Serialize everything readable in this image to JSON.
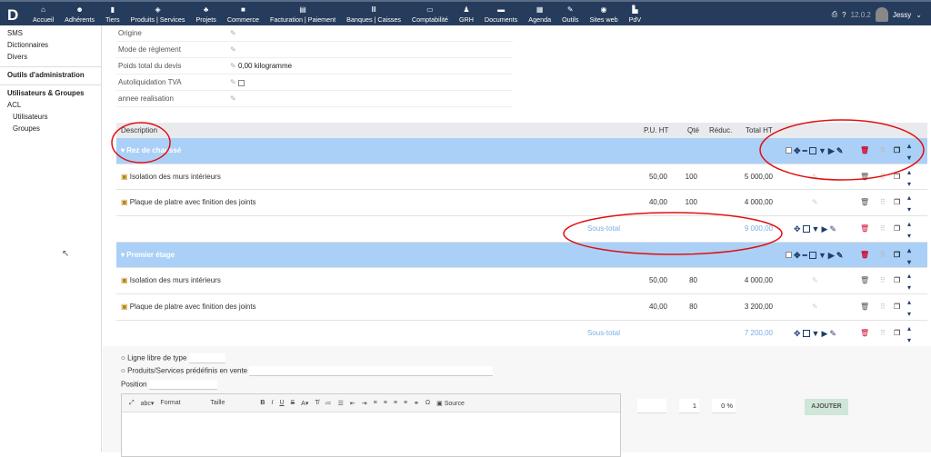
{
  "nav": {
    "logo": "D",
    "items": [
      {
        "icon": "home-icon",
        "glyph": "⌂",
        "label": "Accueil"
      },
      {
        "icon": "users-icon",
        "glyph": "☻",
        "label": "Adhérents"
      },
      {
        "icon": "building-icon",
        "glyph": "▮",
        "label": "Tiers"
      },
      {
        "icon": "cube-icon",
        "glyph": "◈",
        "label": "Produits | Services"
      },
      {
        "icon": "sitemap-icon",
        "glyph": "♣",
        "label": "Projets"
      },
      {
        "icon": "suitcase-icon",
        "glyph": "■",
        "label": "Commerce"
      },
      {
        "icon": "bills-icon",
        "glyph": "▤",
        "label": "Facturation | Paiement"
      },
      {
        "icon": "bank-icon",
        "glyph": "Ⅲ",
        "label": "Banques | Caisses"
      },
      {
        "icon": "calculator-icon",
        "glyph": "▭",
        "label": "Comptabilité"
      },
      {
        "icon": "user-tie-icon",
        "glyph": "♟",
        "label": "GRH"
      },
      {
        "icon": "folder-icon",
        "glyph": "▬",
        "label": "Documents"
      },
      {
        "icon": "calendar-icon",
        "glyph": "▦",
        "label": "Agenda"
      },
      {
        "icon": "wrench-icon",
        "glyph": "✎",
        "label": "Outils"
      },
      {
        "icon": "globe-icon",
        "glyph": "◉",
        "label": "Sites web"
      },
      {
        "icon": "cash-register-icon",
        "glyph": "▙",
        "label": "PdV"
      }
    ],
    "version": "12.0.2",
    "user": "Jessy"
  },
  "sidebar": {
    "items": [
      "SMS",
      "Dictionnaires",
      "Divers"
    ],
    "admin_tools": "Outils d'administration",
    "users_groups": "Utilisateurs & Groupes",
    "acl": "ACL",
    "users": "Utilisateurs",
    "groups": "Groupes"
  },
  "fields": [
    {
      "label": "Origine",
      "value": ""
    },
    {
      "label": "Mode de règlement",
      "value": ""
    },
    {
      "label": "Poids total du devis",
      "value": "0,00 kilogramme"
    },
    {
      "label": "Autoliquidation TVA",
      "value": ""
    },
    {
      "label": "annee realisation",
      "value": ""
    }
  ],
  "table": {
    "headers": {
      "desc": "Description",
      "pu": "P.U. HT",
      "qty": "Qté",
      "disc": "Réduc.",
      "total": "Total HT"
    },
    "groups": [
      {
        "title": "Rez de chaussé",
        "lines": [
          {
            "desc": "Isolation des murs intérieurs",
            "pu": "50,00",
            "qty": "100",
            "total": "5 000,00"
          },
          {
            "desc": "Plaque de platre avec finition des joints",
            "pu": "40,00",
            "qty": "100",
            "total": "4 000,00"
          }
        ],
        "subtotal_label": "Sous-total",
        "subtotal": "9 000,00"
      },
      {
        "title": "Premier étage",
        "lines": [
          {
            "desc": "Isolation des murs intérieurs",
            "pu": "50,00",
            "qty": "80",
            "total": "4 000,00"
          },
          {
            "desc": "Plaque de platre avec finition des joints",
            "pu": "40,00",
            "qty": "80",
            "total": "3 200,00"
          }
        ],
        "subtotal_label": "Sous-total",
        "subtotal": "7 200,00"
      }
    ]
  },
  "form": {
    "free_line": "Ligne libre de type",
    "predefined": "Produits/Services prédéfinis en vente",
    "position": "Position",
    "toolbar": {
      "format": "Format",
      "size": "Taille",
      "bold": "B",
      "italic": "I",
      "underline": "U",
      "strike": "S",
      "source": "Source"
    },
    "qty": "1",
    "discount": "0 %",
    "add": "AJOUTER"
  }
}
